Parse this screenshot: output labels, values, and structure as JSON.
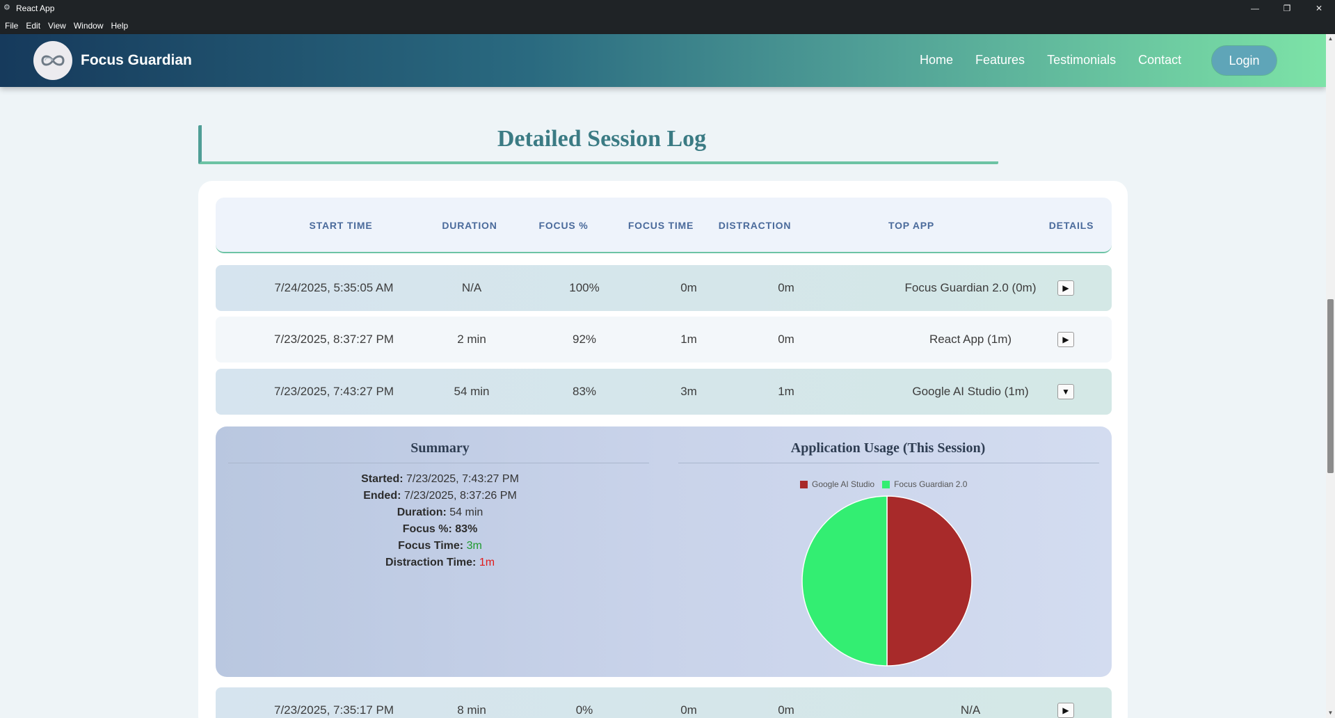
{
  "window": {
    "title": "React App",
    "menu": [
      "File",
      "Edit",
      "View",
      "Window",
      "Help"
    ]
  },
  "nav": {
    "brand": "Focus Guardian",
    "links": [
      "Home",
      "Features",
      "Testimonials",
      "Contact"
    ],
    "login": "Login"
  },
  "section": {
    "title": "Detailed Session Log"
  },
  "table": {
    "headers": [
      "START TIME",
      "DURATION",
      "FOCUS %",
      "FOCUS TIME",
      "DISTRACTION",
      "TOP APP",
      "DETAILS"
    ],
    "rows": [
      {
        "start": "7/24/2025, 5:35:05 AM",
        "duration": "N/A",
        "focus_pct": "100%",
        "focus_time": "0m",
        "distraction": "0m",
        "top_app": "Focus Guardian 2.0 (0m)",
        "toggle": "▶"
      },
      {
        "start": "7/23/2025, 8:37:27 PM",
        "duration": "2 min",
        "focus_pct": "92%",
        "focus_time": "1m",
        "distraction": "0m",
        "top_app": "React App (1m)",
        "toggle": "▶"
      },
      {
        "start": "7/23/2025, 7:43:27 PM",
        "duration": "54 min",
        "focus_pct": "83%",
        "focus_time": "3m",
        "distraction": "1m",
        "top_app": "Google AI Studio (1m)",
        "toggle": "▼"
      },
      {
        "start": "7/23/2025, 7:35:17 PM",
        "duration": "8 min",
        "focus_pct": "0%",
        "focus_time": "0m",
        "distraction": "0m",
        "top_app": "N/A",
        "toggle": "▶"
      }
    ]
  },
  "details": {
    "summary_title": "Summary",
    "started_label": "Started:",
    "started": "7/23/2025, 7:43:27 PM",
    "ended_label": "Ended:",
    "ended": "7/23/2025, 8:37:26 PM",
    "duration_label": "Duration:",
    "duration": "54 min",
    "focus_pct_label": "Focus %:",
    "focus_pct": "83%",
    "focus_time_label": "Focus Time:",
    "focus_time": "3m",
    "distraction_label": "Distraction Time:",
    "distraction": "1m",
    "chart_title": "Application Usage (This Session)"
  },
  "chart_data": {
    "type": "pie",
    "labels": [
      "Google AI Studio",
      "Focus Guardian 2.0"
    ],
    "values": [
      50,
      50
    ],
    "colors": [
      "#a82a2a",
      "#33ee72"
    ]
  }
}
